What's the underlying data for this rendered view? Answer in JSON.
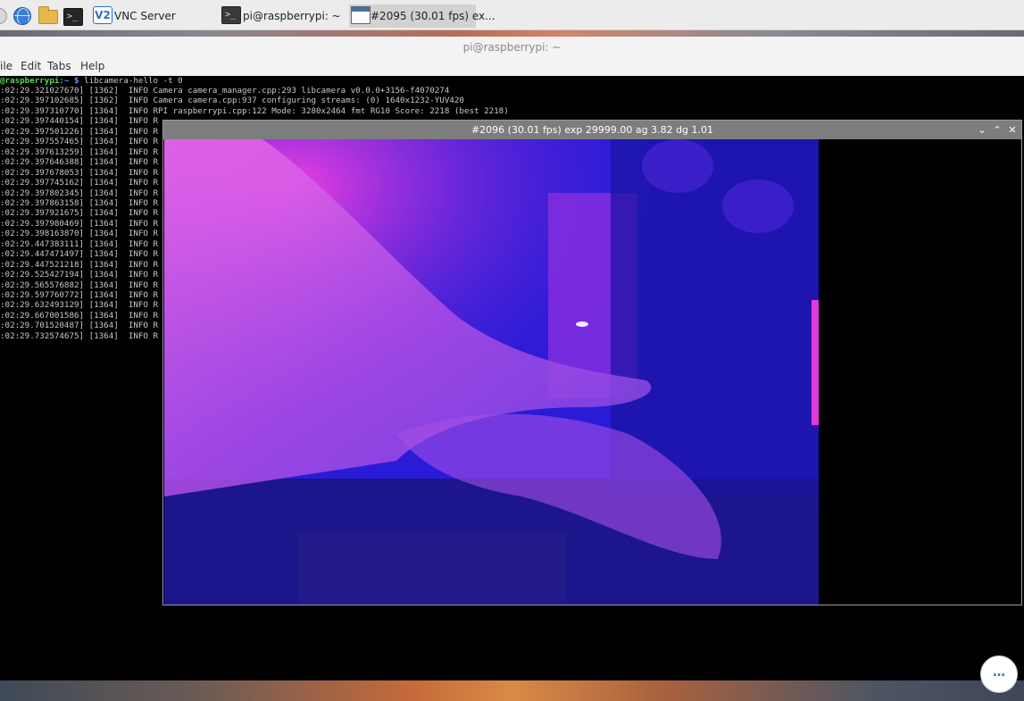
{
  "taskbar": {
    "launchers": [
      "menu-icon",
      "browser-icon",
      "file-manager-icon",
      "terminal-icon"
    ],
    "tasks": [
      {
        "label": "VNC Server",
        "icon": "vnc-icon",
        "icon_text": "V2"
      },
      {
        "label": "pi@raspberrypi: ~",
        "icon": "terminal-icon"
      },
      {
        "label": "#2095 (30.01 fps) ex...",
        "icon": "window-icon",
        "active": true
      }
    ]
  },
  "terminal": {
    "title": "pi@raspberrypi: ~",
    "menu": [
      "ile",
      "Edit",
      "Tabs",
      "Help"
    ],
    "prompt": {
      "user": "@raspberrypi",
      "path": ":~ $",
      "command": " libcamera-hello -t 0"
    },
    "lines": [
      ":02:29.321027670] [1362]  INFO Camera camera_manager.cpp:293 libcamera v0.0.0+3156-f4070274",
      ":02:29.397102685] [1362]  INFO Camera camera.cpp:937 configuring streams: (0) 1640x1232-YUV420",
      ":02:29.397310770] [1364]  INFO RPI raspberrypi.cpp:122 Mode: 3280x2464 fmt RG10 Score: 2218 (best 2218)",
      ":02:29.397440154] [1364]  INFO R",
      ":02:29.397501226] [1364]  INFO R",
      ":02:29.397557465] [1364]  INFO R",
      ":02:29.397613259] [1364]  INFO R",
      ":02:29.397646388] [1364]  INFO R",
      ":02:29.397678053] [1364]  INFO R",
      ":02:29.397745162] [1364]  INFO R",
      ":02:29.397802345] [1364]  INFO R",
      ":02:29.397863158] [1364]  INFO R",
      ":02:29.397921675] [1364]  INFO R",
      ":02:29.397980469] [1364]  INFO R",
      ":02:29.398163870] [1364]  INFO R",
      ":02:29.447383111] [1364]  INFO R",
      ":02:29.447471497] [1364]  INFO R",
      ":02:29.447521218] [1364]  INFO R",
      ":02:29.525427194] [1364]  INFO R",
      ":02:29.565576882] [1364]  INFO R",
      ":02:29.597760772] [1364]  INFO R",
      ":02:29.632493129] [1364]  INFO R",
      ":02:29.667001586] [1364]  INFO R",
      ":02:29.701520487] [1364]  INFO R",
      ":02:29.732574675] [1364]  INFO R"
    ]
  },
  "camera_window": {
    "title": "#2096 (30.01 fps) exp 29999.00 ag 3.82 dg 1.01",
    "buttons": [
      "minimize-icon",
      "maximize-icon",
      "close-icon"
    ],
    "button_glyphs": [
      "⌄",
      "⌃",
      "✕"
    ]
  },
  "fab": {
    "label": "…"
  },
  "colors": {
    "prompt_user": "#5ed35e",
    "prompt_path": "#6a8cf0",
    "camera_titlebar": "#7d7d7d",
    "preview_tint": "#2a1bd6",
    "accent": "#2f6fc9"
  }
}
